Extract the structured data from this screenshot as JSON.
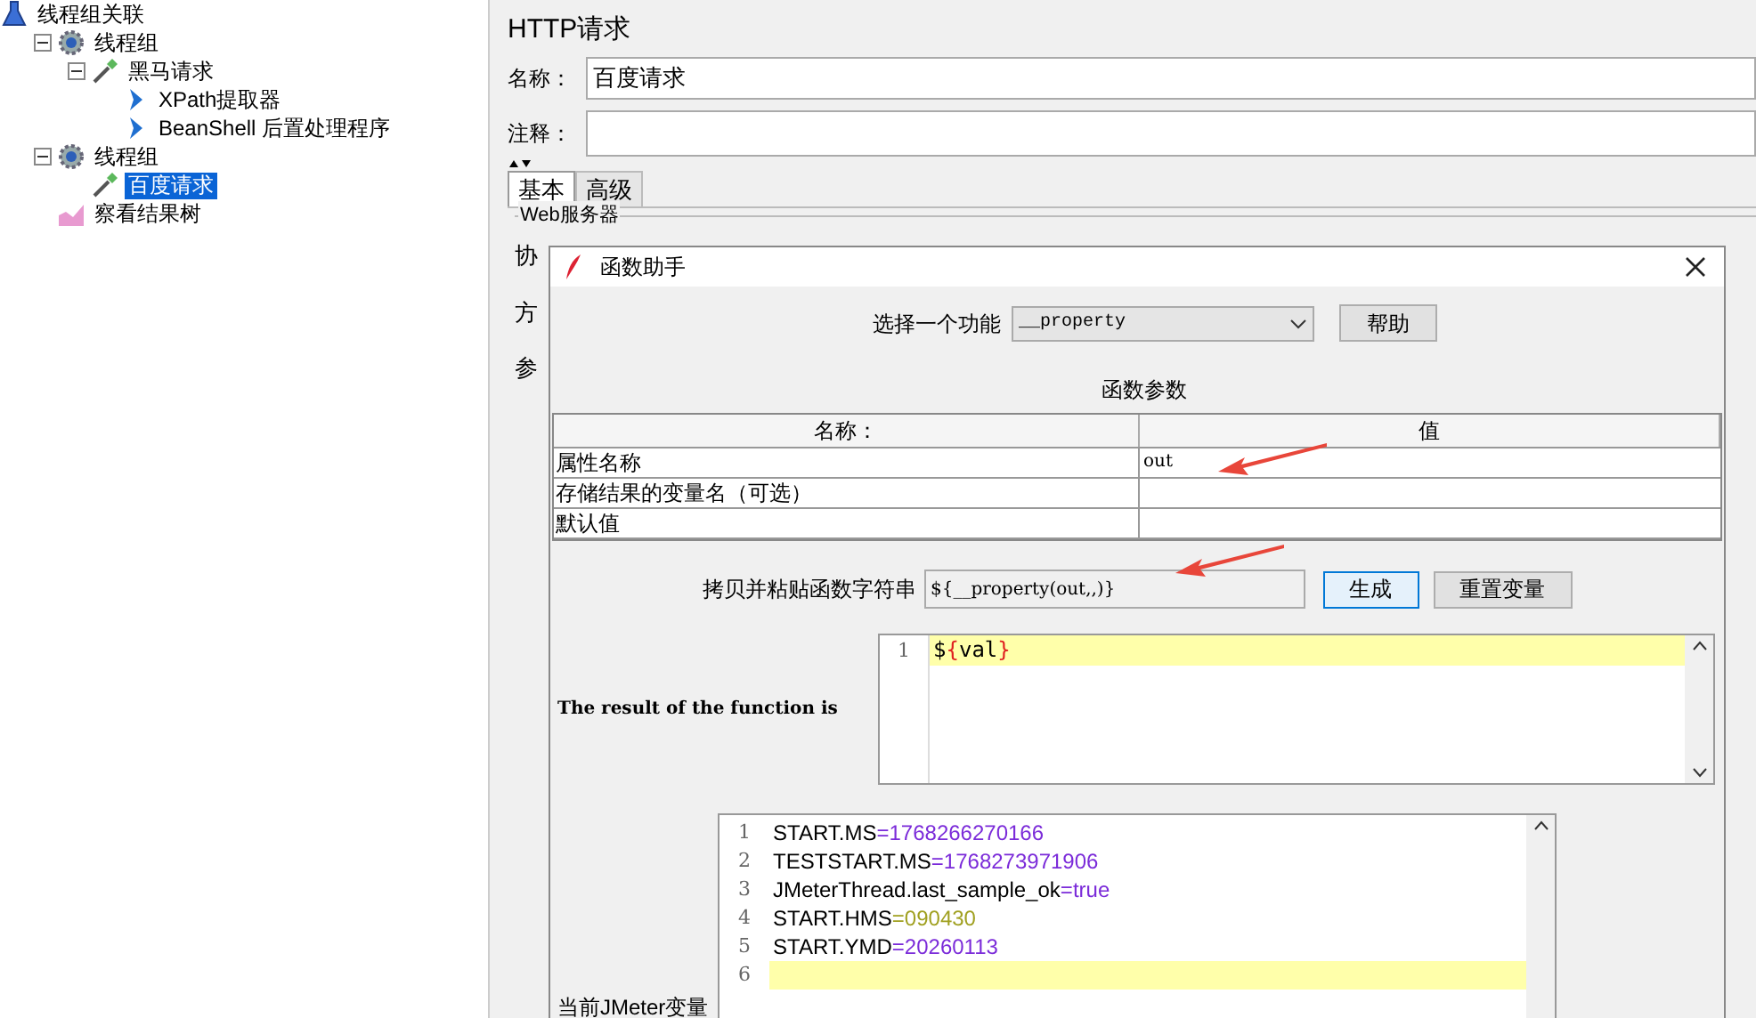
{
  "tree": [
    {
      "label": "线程组关联",
      "kind": "plan",
      "selected": false,
      "children": [
        {
          "label": "线程组",
          "kind": "group",
          "selected": false,
          "expanded": true,
          "children": [
            {
              "label": "黑马请求",
              "kind": "sampler",
              "selected": false,
              "expanded": true,
              "children": [
                {
                  "label": "XPath提取器",
                  "kind": "postprocessor",
                  "selected": false
                },
                {
                  "label": "BeanShell 后置处理程序",
                  "kind": "postprocessor",
                  "selected": false
                }
              ]
            }
          ]
        },
        {
          "label": "线程组",
          "kind": "group",
          "selected": false,
          "expanded": true,
          "children": [
            {
              "label": "百度请求",
              "kind": "sampler",
              "selected": true
            }
          ]
        },
        {
          "label": "察看结果树",
          "kind": "listener",
          "selected": false
        }
      ]
    }
  ],
  "panel": {
    "title": "HTTP请求",
    "name_label": "名称：",
    "name_value": "百度请求",
    "comment_label": "注释：",
    "tabs": [
      {
        "label": "基本",
        "selected": true
      },
      {
        "label": "高级",
        "selected": false
      }
    ],
    "group_title": "Web服务器",
    "fragments": [
      "协",
      "方",
      "参"
    ]
  },
  "dialog": {
    "title": "函数助手",
    "select_label": "选择一个功能",
    "select_value": "__property",
    "help_button": "帮助",
    "params_title": "函数参数",
    "columns": [
      "名称：",
      "值"
    ],
    "rows": [
      {
        "name": "属性名称",
        "value": "out"
      },
      {
        "name": "存储结果的变量名（可选）"
      },
      {
        "name": "默认值"
      }
    ],
    "copy_label": "拷贝并粘贴函数字符串",
    "copy_value": "${__property(out,,)}",
    "generate_button": "生成",
    "reset_button": "重置变量",
    "result_label": "The result of the function is",
    "result_lines": [
      {
        "number": "1",
        "current": true,
        "segments": [
          {
            "text": "$",
            "kind": "plain"
          },
          {
            "text": "{",
            "kind": "brace"
          },
          {
            "text": "val",
            "kind": "plain"
          },
          {
            "text": "}",
            "kind": "brace"
          }
        ]
      }
    ],
    "vars_label": "当前JMeter变量",
    "var_lines": [
      {
        "number": "1",
        "name": "START.MS",
        "op": "=",
        "value": "1768266270166",
        "kind": "number",
        "current": false
      },
      {
        "number": "2",
        "name": "TESTSTART.MS",
        "op": "=",
        "value": "1768273971906",
        "kind": "number",
        "current": false
      },
      {
        "number": "3",
        "name": "JMeterThread.last_sample_ok",
        "op": "=",
        "value": "true",
        "kind": "keyword",
        "current": false
      },
      {
        "number": "4",
        "name": "START.HMS",
        "op": "=",
        "value": "090430",
        "kind": "octal",
        "current": false
      },
      {
        "number": "5",
        "name": "START.YMD",
        "op": "=",
        "value": "20260113",
        "kind": "number",
        "current": false
      },
      {
        "number": "6",
        "current": true
      }
    ]
  }
}
